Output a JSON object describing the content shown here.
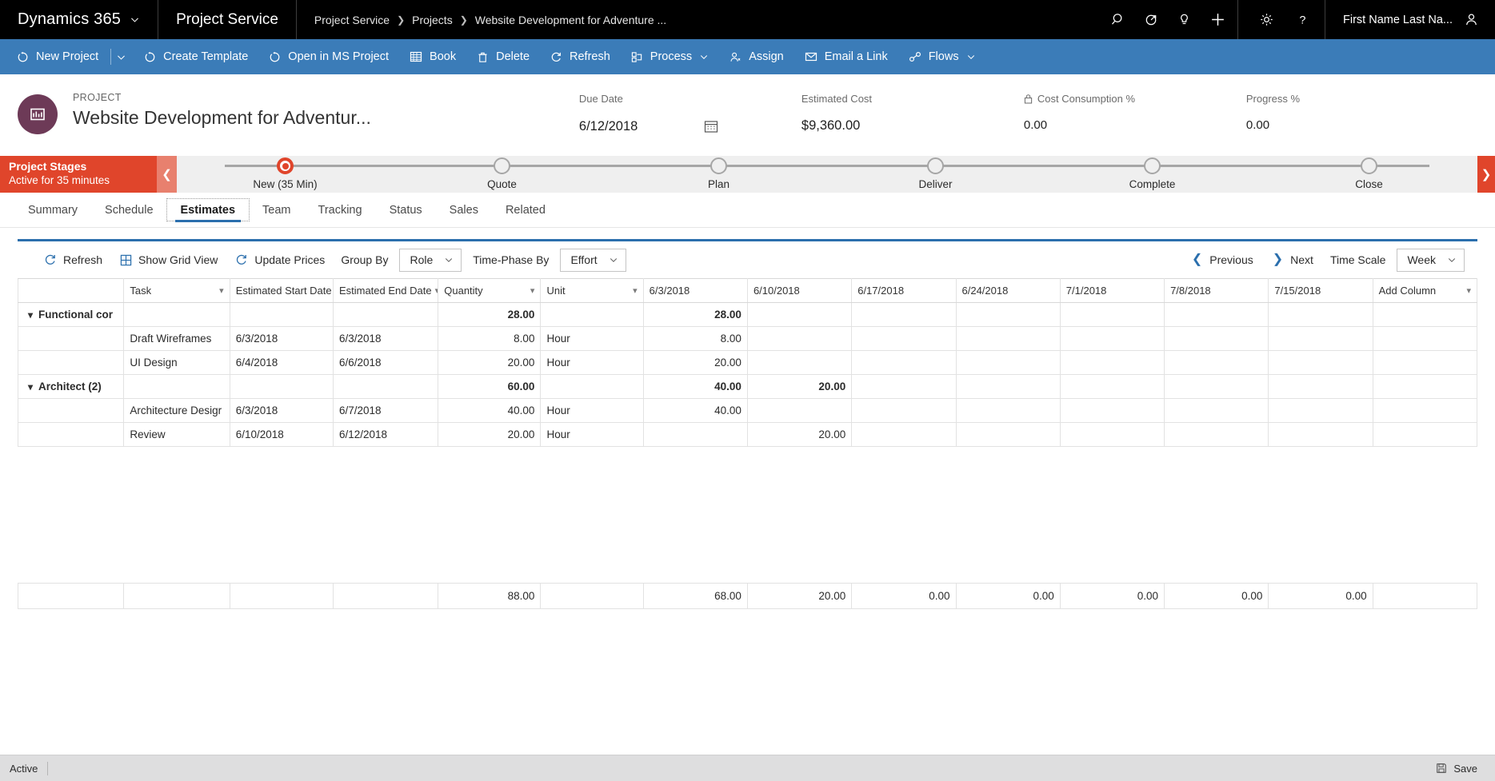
{
  "topbar": {
    "brand": "Dynamics 365",
    "brand_caret_icon": "chevron-down-icon",
    "app_name": "Project Service",
    "breadcrumbs": [
      "Project Service",
      "Projects",
      "Website Development for Adventure ..."
    ],
    "icons": [
      "search-icon",
      "assistant-icon",
      "lightbulb-icon",
      "plus-icon"
    ],
    "icons_right": [
      "gear-icon",
      "help-icon"
    ],
    "user_name": "First Name Last Na...",
    "user_icon": "person-icon"
  },
  "commandbar": {
    "items": [
      {
        "label": "New Project",
        "icon": "new-project-icon",
        "has_caret": true
      },
      {
        "label": "Create Template",
        "icon": "create-template-icon",
        "has_caret": false
      },
      {
        "label": "Open in MS Project",
        "icon": "open-ms-project-icon",
        "has_caret": false
      },
      {
        "label": "Book",
        "icon": "book-grid-icon",
        "has_caret": false
      },
      {
        "label": "Delete",
        "icon": "trash-icon",
        "has_caret": false
      },
      {
        "label": "Refresh",
        "icon": "refresh-icon",
        "has_caret": false
      },
      {
        "label": "Process",
        "icon": "process-icon",
        "has_caret": true
      },
      {
        "label": "Assign",
        "icon": "assign-person-icon",
        "has_caret": false
      },
      {
        "label": "Email a Link",
        "icon": "email-link-icon",
        "has_caret": false
      },
      {
        "label": "Flows",
        "icon": "flows-icon",
        "has_caret": true
      }
    ]
  },
  "project_header": {
    "kicker": "PROJECT",
    "name": "Website Development for Adventur...",
    "avatar_icon": "project-entity-icon",
    "fields": [
      {
        "label": "Due Date",
        "value": "6/12/2018",
        "icon": "calendar-icon",
        "lock": false
      },
      {
        "label": "Estimated Cost",
        "value": "$9,360.00",
        "icon": "",
        "lock": false
      },
      {
        "label": "Cost Consumption %",
        "value": "0.00",
        "icon": "",
        "lock": true
      },
      {
        "label": "Progress %",
        "value": "0.00",
        "icon": "",
        "lock": false
      }
    ]
  },
  "process_flow": {
    "title": "Project Stages",
    "subtitle": "Active for 35 minutes",
    "collapse_icon": "chevron-left-icon",
    "next_icon": "chevron-right-icon",
    "stages": [
      {
        "label": "New  (35 Min)",
        "active": true
      },
      {
        "label": "Quote",
        "active": false
      },
      {
        "label": "Plan",
        "active": false
      },
      {
        "label": "Deliver",
        "active": false
      },
      {
        "label": "Complete",
        "active": false
      },
      {
        "label": "Close",
        "active": false
      }
    ]
  },
  "tabs": [
    {
      "label": "Summary",
      "selected": false
    },
    {
      "label": "Schedule",
      "selected": false
    },
    {
      "label": "Estimates",
      "selected": true
    },
    {
      "label": "Team",
      "selected": false
    },
    {
      "label": "Tracking",
      "selected": false
    },
    {
      "label": "Status",
      "selected": false
    },
    {
      "label": "Sales",
      "selected": false
    },
    {
      "label": "Related",
      "selected": false
    }
  ],
  "grid_toolbar": {
    "refresh_label": "Refresh",
    "refresh_icon": "refresh-icon",
    "show_grid_label": "Show Grid View",
    "show_grid_icon": "grid-view-icon",
    "update_prices_label": "Update Prices",
    "update_prices_icon": "refresh-icon",
    "group_by_label": "Group By",
    "group_by_value": "Role",
    "time_phase_label": "Time-Phase By",
    "time_phase_value": "Effort",
    "previous_label": "Previous",
    "previous_icon": "chevron-left-icon",
    "next_label": "Next",
    "next_icon": "chevron-right-icon",
    "time_scale_label": "Time Scale",
    "time_scale_value": "Week",
    "caret_icon": "chevron-down-icon"
  },
  "grid": {
    "columns": [
      {
        "label": "",
        "sortable": false,
        "align": "left"
      },
      {
        "label": "Task",
        "sortable": true,
        "align": "left"
      },
      {
        "label": "Estimated Start Date",
        "sortable": true,
        "align": "left"
      },
      {
        "label": "Estimated End Date",
        "sortable": true,
        "align": "left"
      },
      {
        "label": "Quantity",
        "sortable": true,
        "align": "right"
      },
      {
        "label": "Unit",
        "sortable": true,
        "align": "left"
      },
      {
        "label": "6/3/2018",
        "sortable": false,
        "align": "right"
      },
      {
        "label": "6/10/2018",
        "sortable": false,
        "align": "right"
      },
      {
        "label": "6/17/2018",
        "sortable": false,
        "align": "right"
      },
      {
        "label": "6/24/2018",
        "sortable": false,
        "align": "right"
      },
      {
        "label": "7/1/2018",
        "sortable": false,
        "align": "right"
      },
      {
        "label": "7/8/2018",
        "sortable": false,
        "align": "right"
      },
      {
        "label": "7/15/2018",
        "sortable": false,
        "align": "right"
      },
      {
        "label": "Add Column",
        "sortable": true,
        "align": "left"
      }
    ],
    "rows": [
      {
        "type": "group",
        "caret_icon": "chevron-down-icon",
        "name": "Functional cor",
        "start": "",
        "end": "",
        "quantity": "28.00",
        "unit": "",
        "weeks": [
          "28.00",
          "",
          "",
          "",
          "",
          "",
          ""
        ]
      },
      {
        "type": "task",
        "name": "Draft Wireframes",
        "start": "6/3/2018",
        "end": "6/3/2018",
        "quantity": "8.00",
        "unit": "Hour",
        "weeks": [
          "8.00",
          "",
          "",
          "",
          "",
          "",
          ""
        ]
      },
      {
        "type": "task",
        "name": "UI Design",
        "start": "6/4/2018",
        "end": "6/6/2018",
        "quantity": "20.00",
        "unit": "Hour",
        "weeks": [
          "20.00",
          "",
          "",
          "",
          "",
          "",
          ""
        ]
      },
      {
        "type": "group",
        "caret_icon": "chevron-down-icon",
        "name": "Architect (2)",
        "start": "",
        "end": "",
        "quantity": "60.00",
        "unit": "",
        "weeks": [
          "40.00",
          "20.00",
          "",
          "",
          "",
          "",
          ""
        ]
      },
      {
        "type": "task",
        "name": "Architecture Desigr",
        "start": "6/3/2018",
        "end": "6/7/2018",
        "quantity": "40.00",
        "unit": "Hour",
        "weeks": [
          "40.00",
          "",
          "",
          "",
          "",
          "",
          ""
        ]
      },
      {
        "type": "task",
        "name": "Review",
        "start": "6/10/2018",
        "end": "6/12/2018",
        "quantity": "20.00",
        "unit": "Hour",
        "weeks": [
          "",
          "20.00",
          "",
          "",
          "",
          "",
          ""
        ]
      }
    ],
    "totals": {
      "blank1": "",
      "blank2": "",
      "blank3": "",
      "blank4": "",
      "quantity": "88.00",
      "unit": "",
      "weeks": [
        "68.00",
        "20.00",
        "0.00",
        "0.00",
        "0.00",
        "0.00",
        "0.00"
      ],
      "trailing": ""
    }
  },
  "statusbar": {
    "state": "Active",
    "save_label": "Save",
    "save_icon": "save-icon"
  },
  "colors": {
    "topbar_bg": "#000000",
    "command_bar_bg": "#3b7cb8",
    "accent_blue": "#2b6fad",
    "bpf_red": "#e0452b",
    "avatar_purple": "#6d3a57",
    "status_bg": "#dededf"
  }
}
